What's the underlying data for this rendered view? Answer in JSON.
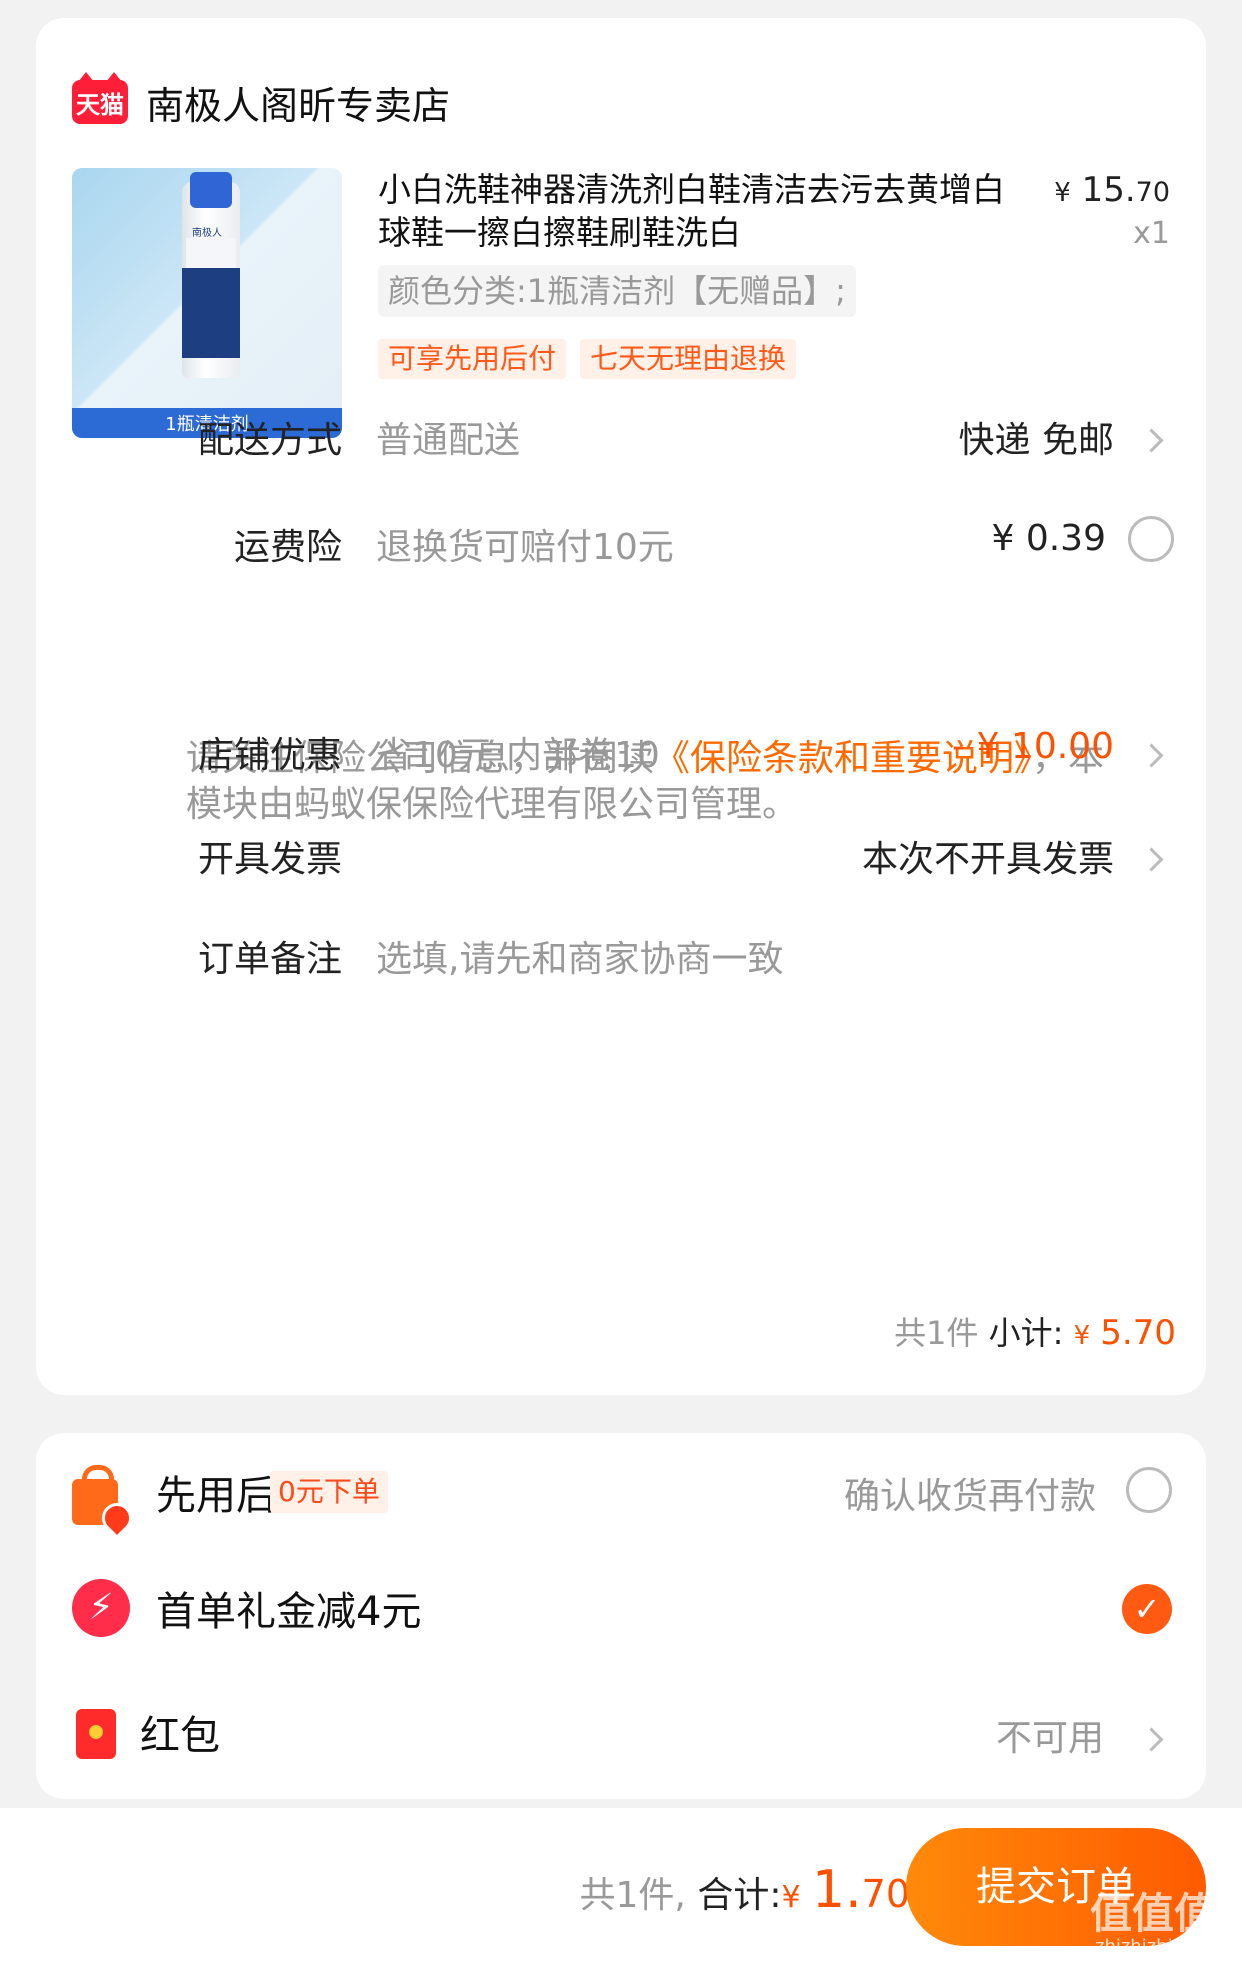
{
  "store": {
    "logo_text": "天猫",
    "name": "南极人阁昕专卖店"
  },
  "product": {
    "image_band": "1瓶清洁剂",
    "image_brand": "南极人",
    "title": "小白洗鞋神器清洗剂白鞋清洁去污去黄增白球鞋一擦白擦鞋刷鞋洗白",
    "spec": "颜色分类:1瓶清洁剂【无赠品】;",
    "tags": [
      "可享先用后付",
      "七天无理由退换"
    ],
    "price_yen": "¥",
    "price_int": "15.",
    "price_dec": "70",
    "qty": "x1"
  },
  "delivery": {
    "label": "配送方式",
    "value": "普通配送",
    "right": "快递 免邮"
  },
  "insurance": {
    "label": "运费险",
    "value": "退换货可赔付10元",
    "right": "¥ 0.39",
    "note_prefix": "请关注保险公司信息，并阅读",
    "note_link": "《保险条款和重要说明》",
    "note_suffix": "，本模块由蚂蚁保保险代理有限公司管理。"
  },
  "discount": {
    "label": "店铺优惠",
    "value": "省10元:内部卷10",
    "right": "- ¥ 10.00"
  },
  "invoice": {
    "label": "开具发票",
    "right": "本次不开具发票"
  },
  "remark": {
    "label": "订单备注",
    "placeholder": "选填,请先和商家协商一致"
  },
  "subtotal": {
    "count": "共1件",
    "label": "小计:",
    "yen": "¥",
    "amount": "5.70"
  },
  "options": {
    "pay_later": {
      "title": "先用后付",
      "badge": "0元下单",
      "right": "确认收货再付款"
    },
    "first_order": {
      "title": "首单礼金减4元"
    },
    "red_packet": {
      "title": "红包",
      "right": "不可用"
    }
  },
  "footer": {
    "count": "共1件,",
    "label": "合计:",
    "yen": "¥",
    "amount_int": "1.",
    "amount_dec": "70",
    "submit": "提交订单",
    "watermark": "值值值",
    "watermark_sub": "zhizhizhi.com"
  },
  "colors": {
    "accent": "#ff5000",
    "tmall_red": "#ff1e38",
    "muted": "#999999"
  }
}
